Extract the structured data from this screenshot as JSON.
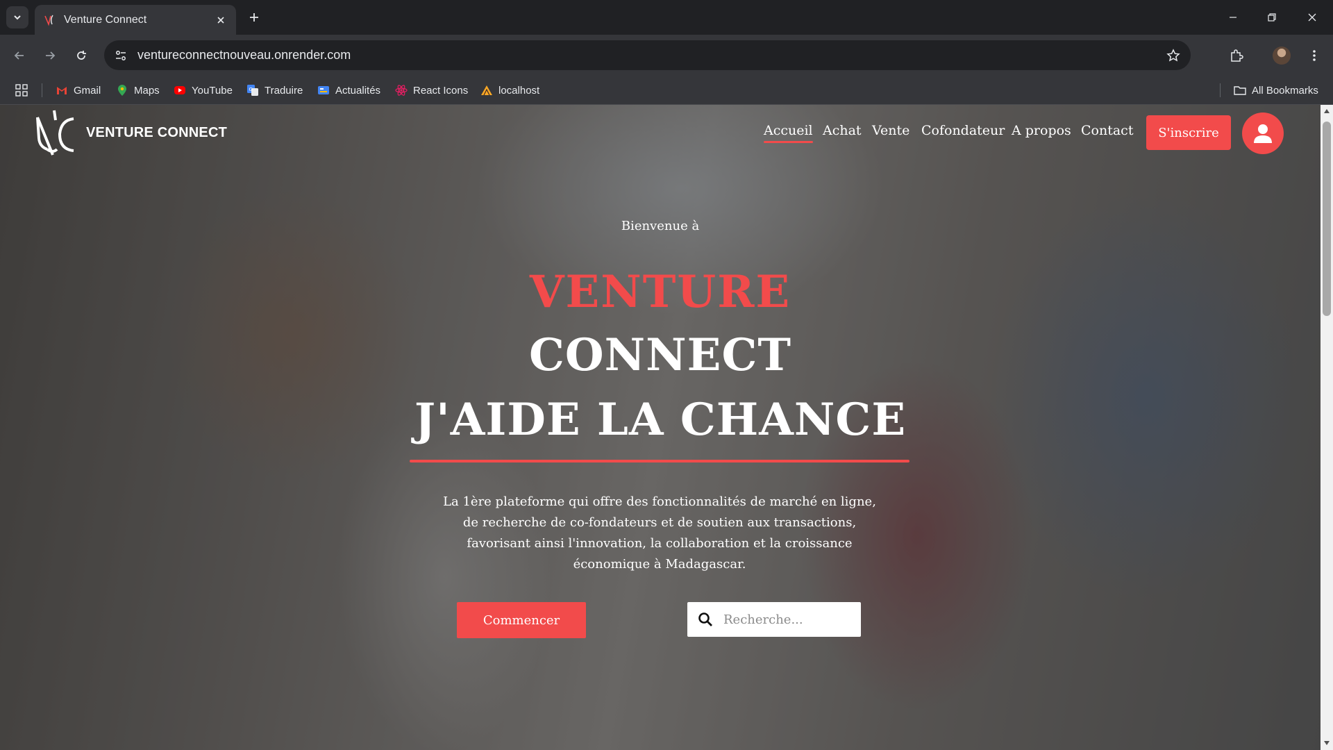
{
  "browser": {
    "tab_title": "Venture Connect",
    "url": "ventureconnectnouveau.onrender.com",
    "bookmarks": [
      {
        "label": "Gmail",
        "icon": "gmail-icon"
      },
      {
        "label": "Maps",
        "icon": "maps-icon"
      },
      {
        "label": "YouTube",
        "icon": "youtube-icon"
      },
      {
        "label": "Traduire",
        "icon": "translate-icon"
      },
      {
        "label": "Actualités",
        "icon": "news-icon"
      },
      {
        "label": "React Icons",
        "icon": "react-icon"
      },
      {
        "label": "localhost",
        "icon": "localhost-icon"
      }
    ],
    "all_bookmarks": "All Bookmarks"
  },
  "site": {
    "logo_text": "VENTURE CONNECT",
    "nav": [
      "Accueil",
      "Achat",
      "Vente",
      "Cofondateur",
      "A propos",
      "Contact"
    ],
    "active_nav": "Accueil",
    "signup_label": "S'inscrire"
  },
  "hero": {
    "welcome": "Bienvenue à",
    "title_accent": "VENTURE",
    "title_main": "CONNECT",
    "tagline": "J'AIDE LA CHANCE",
    "description": "La 1ère plateforme qui offre des fonctionnalités de marché en ligne, de recherche de co-fondateurs et de soutien aux transactions, favorisant ainsi l'innovation, la collaboration et la croissance économique à Madagascar.",
    "cta_label": "Commencer",
    "search_placeholder": "Recherche..."
  },
  "colors": {
    "accent": "#f24b4b",
    "chrome_dark": "#202124",
    "chrome_mid": "#35363a"
  }
}
